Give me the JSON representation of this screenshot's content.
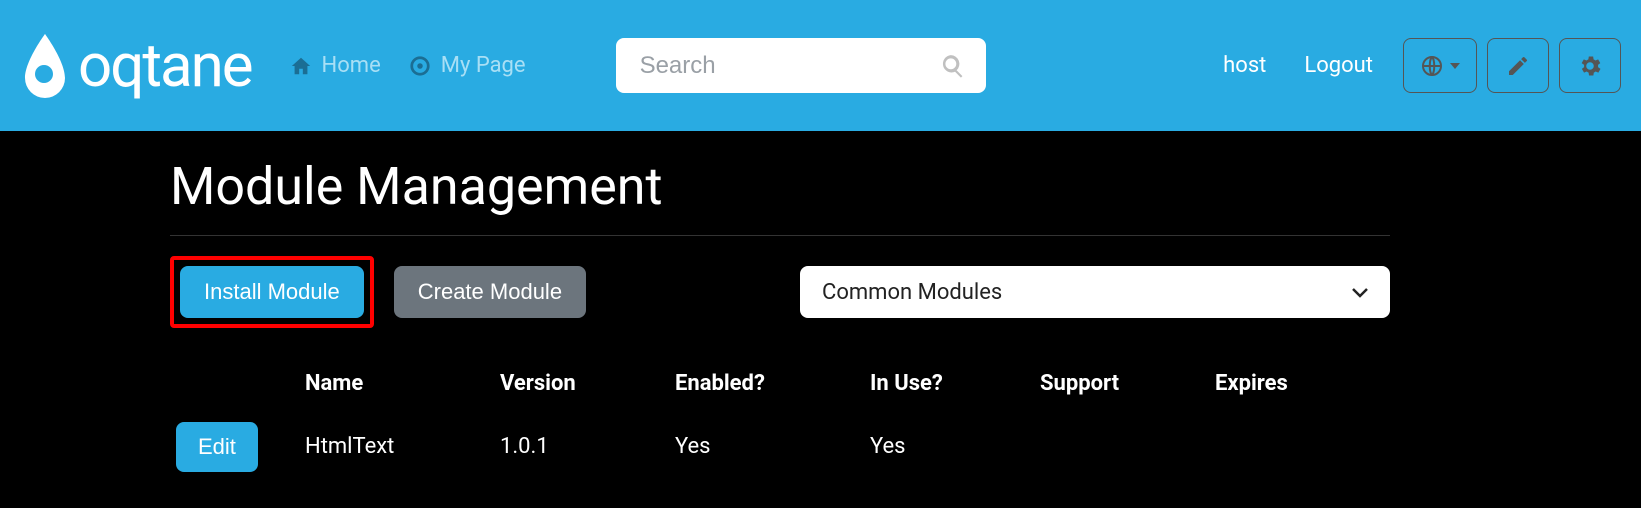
{
  "header": {
    "logo_text": "oqtane",
    "nav": {
      "home": "Home",
      "mypage": "My Page"
    },
    "search_placeholder": "Search",
    "user": "host",
    "logout": "Logout"
  },
  "page": {
    "title": "Module Management",
    "install_label": "Install Module",
    "create_label": "Create Module",
    "filter_selected": "Common Modules"
  },
  "table": {
    "headers": {
      "name": "Name",
      "version": "Version",
      "enabled": "Enabled?",
      "inuse": "In Use?",
      "support": "Support",
      "expires": "Expires"
    },
    "edit_label": "Edit",
    "rows": [
      {
        "name": "HtmlText",
        "version": "1.0.1",
        "enabled": "Yes",
        "inuse": "Yes",
        "support": "",
        "expires": ""
      }
    ]
  }
}
